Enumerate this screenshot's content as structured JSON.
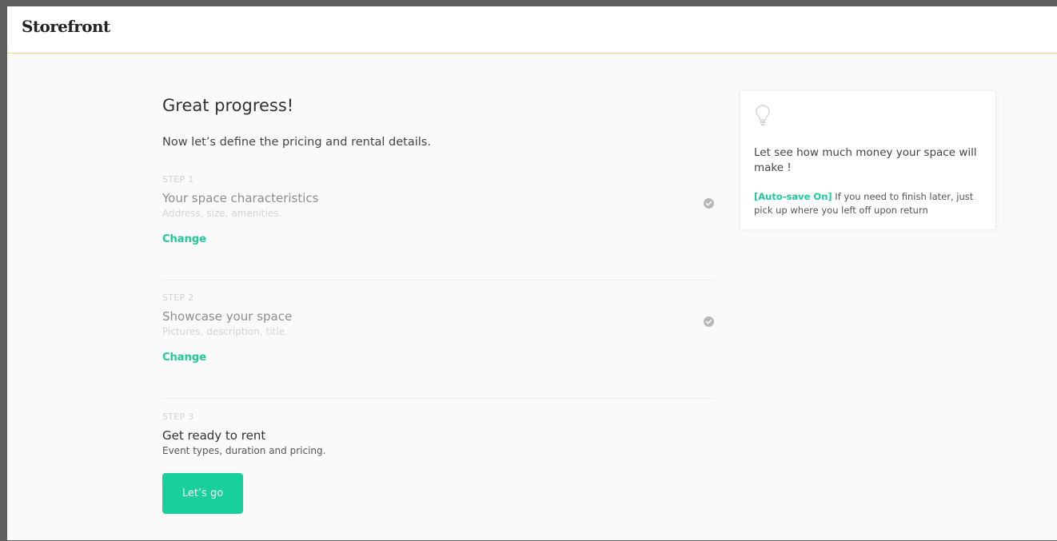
{
  "app": {
    "logo": "Storefront"
  },
  "main": {
    "heading": "Great progress!",
    "intro": "Now let’s define the pricing and rental details.",
    "steps": [
      {
        "number": "STEP 1",
        "title": "Your space characteristics",
        "subtitle": "Address, size, amenities.",
        "link": "Change",
        "status": "completed"
      },
      {
        "number": "STEP 2",
        "title": "Showcase your space",
        "subtitle": "Pictures, description, title.",
        "link": "Change",
        "status": "completed"
      },
      {
        "number": "STEP 3",
        "title": "Get ready to rent",
        "subtitle": "Event types, duration and pricing.",
        "button": "Let’s go",
        "status": "active"
      }
    ]
  },
  "tip": {
    "icon": "lightbulb-icon",
    "text": "Let see how much money your space will make !",
    "autosave_label": "[Auto-save On]",
    "autosave_text": " If you need to finish later, just pick up where you left off upon return"
  },
  "colors": {
    "accent": "#1ec99a",
    "button": "#18d09a",
    "header_border": "#ecd77a",
    "check": "#b8b8b8"
  }
}
